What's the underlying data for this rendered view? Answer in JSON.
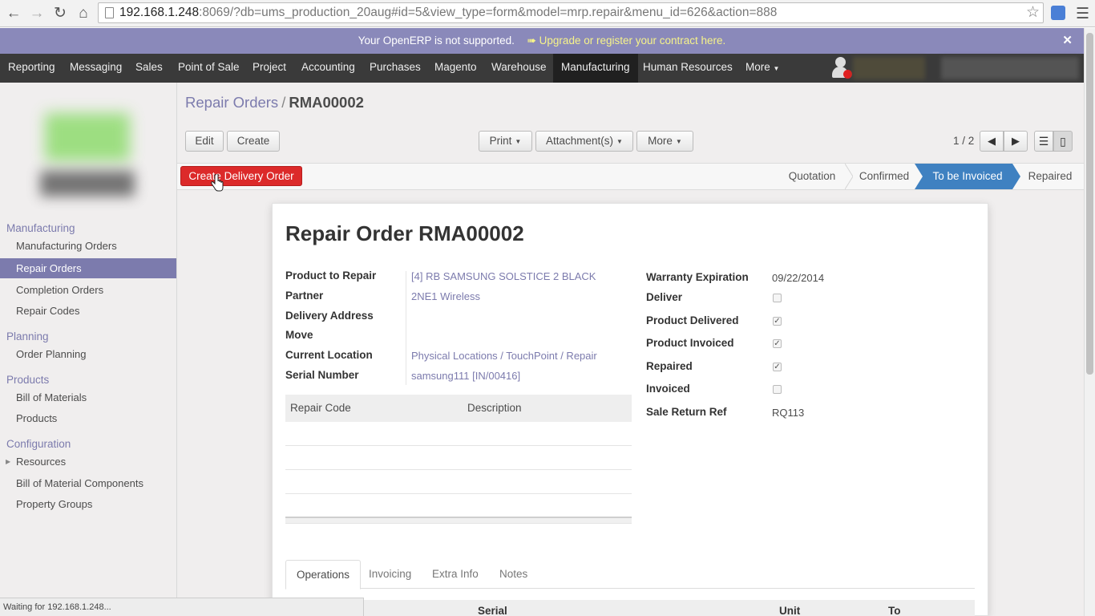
{
  "browser": {
    "url_host": "192.168.1.248",
    "url_rest": ":8069/?db=ums_production_20aug#id=5&view_type=form&model=mrp.repair&menu_id=626&action=888",
    "status_text": "Waiting for 192.168.1.248..."
  },
  "notice": {
    "message": "Your OpenERP is not supported.",
    "link": "Upgrade or register your contract here."
  },
  "topmenu": {
    "items": [
      "Reporting",
      "Messaging",
      "Sales",
      "Point of Sale",
      "Project",
      "Accounting",
      "Purchases",
      "Magento",
      "Warehouse",
      "Manufacturing",
      "Human Resources",
      "More"
    ],
    "active": "Manufacturing"
  },
  "sidebar": {
    "sections": [
      {
        "title": "Manufacturing",
        "items": [
          "Manufacturing Orders",
          "Repair Orders",
          "Completion Orders",
          "Repair Codes"
        ]
      },
      {
        "title": "Planning",
        "items": [
          "Order Planning"
        ]
      },
      {
        "title": "Products",
        "items": [
          "Bill of Materials",
          "Products"
        ]
      },
      {
        "title": "Configuration",
        "items": [
          "Resources",
          "Bill of Material Components",
          "Property Groups"
        ]
      }
    ],
    "active_item": "Repair Orders"
  },
  "breadcrumb": {
    "parent": "Repair Orders",
    "separator": "/",
    "current": "RMA00002"
  },
  "toolbar": {
    "edit": "Edit",
    "create": "Create",
    "print": "Print",
    "attachments": "Attachment(s)",
    "more": "More",
    "pager": "1 / 2"
  },
  "statusline": {
    "action_button": "Create Delivery Order",
    "stages": [
      "Quotation",
      "Confirmed",
      "To be Invoiced",
      "Repaired"
    ],
    "active_stage": "To be Invoiced"
  },
  "form": {
    "title": "Repair Order RMA00002",
    "left_fields": [
      {
        "label": "Product to Repair",
        "value": "[4] RB SAMSUNG SOLSTICE 2 BLACK"
      },
      {
        "label": "Partner",
        "value": "2NE1 Wireless"
      },
      {
        "label": "Delivery Address",
        "value": ""
      },
      {
        "label": "Move",
        "value": ""
      },
      {
        "label": "Current Location",
        "value": "Physical Locations / TouchPoint / Repair"
      },
      {
        "label": "Serial Number",
        "value": "samsung111 [IN/00416]"
      }
    ],
    "right_fields": [
      {
        "label": "Warranty Expiration",
        "value": "09/22/2014"
      },
      {
        "label": "Deliver",
        "checked": false
      },
      {
        "label": "Product Delivered",
        "checked": true
      },
      {
        "label": "Product Invoiced",
        "checked": true
      },
      {
        "label": "Repaired",
        "checked": true
      },
      {
        "label": "Invoiced",
        "checked": false
      },
      {
        "label": "Sale Return Ref",
        "value": "RQ113"
      }
    ],
    "repair_grid": {
      "columns": [
        "Repair Code",
        "Description"
      ]
    },
    "tabs": [
      "Operations",
      "Invoicing",
      "Extra Info",
      "Notes"
    ],
    "active_tab": "Operations",
    "operations_columns": [
      "Serial",
      "Unit",
      "To"
    ]
  }
}
